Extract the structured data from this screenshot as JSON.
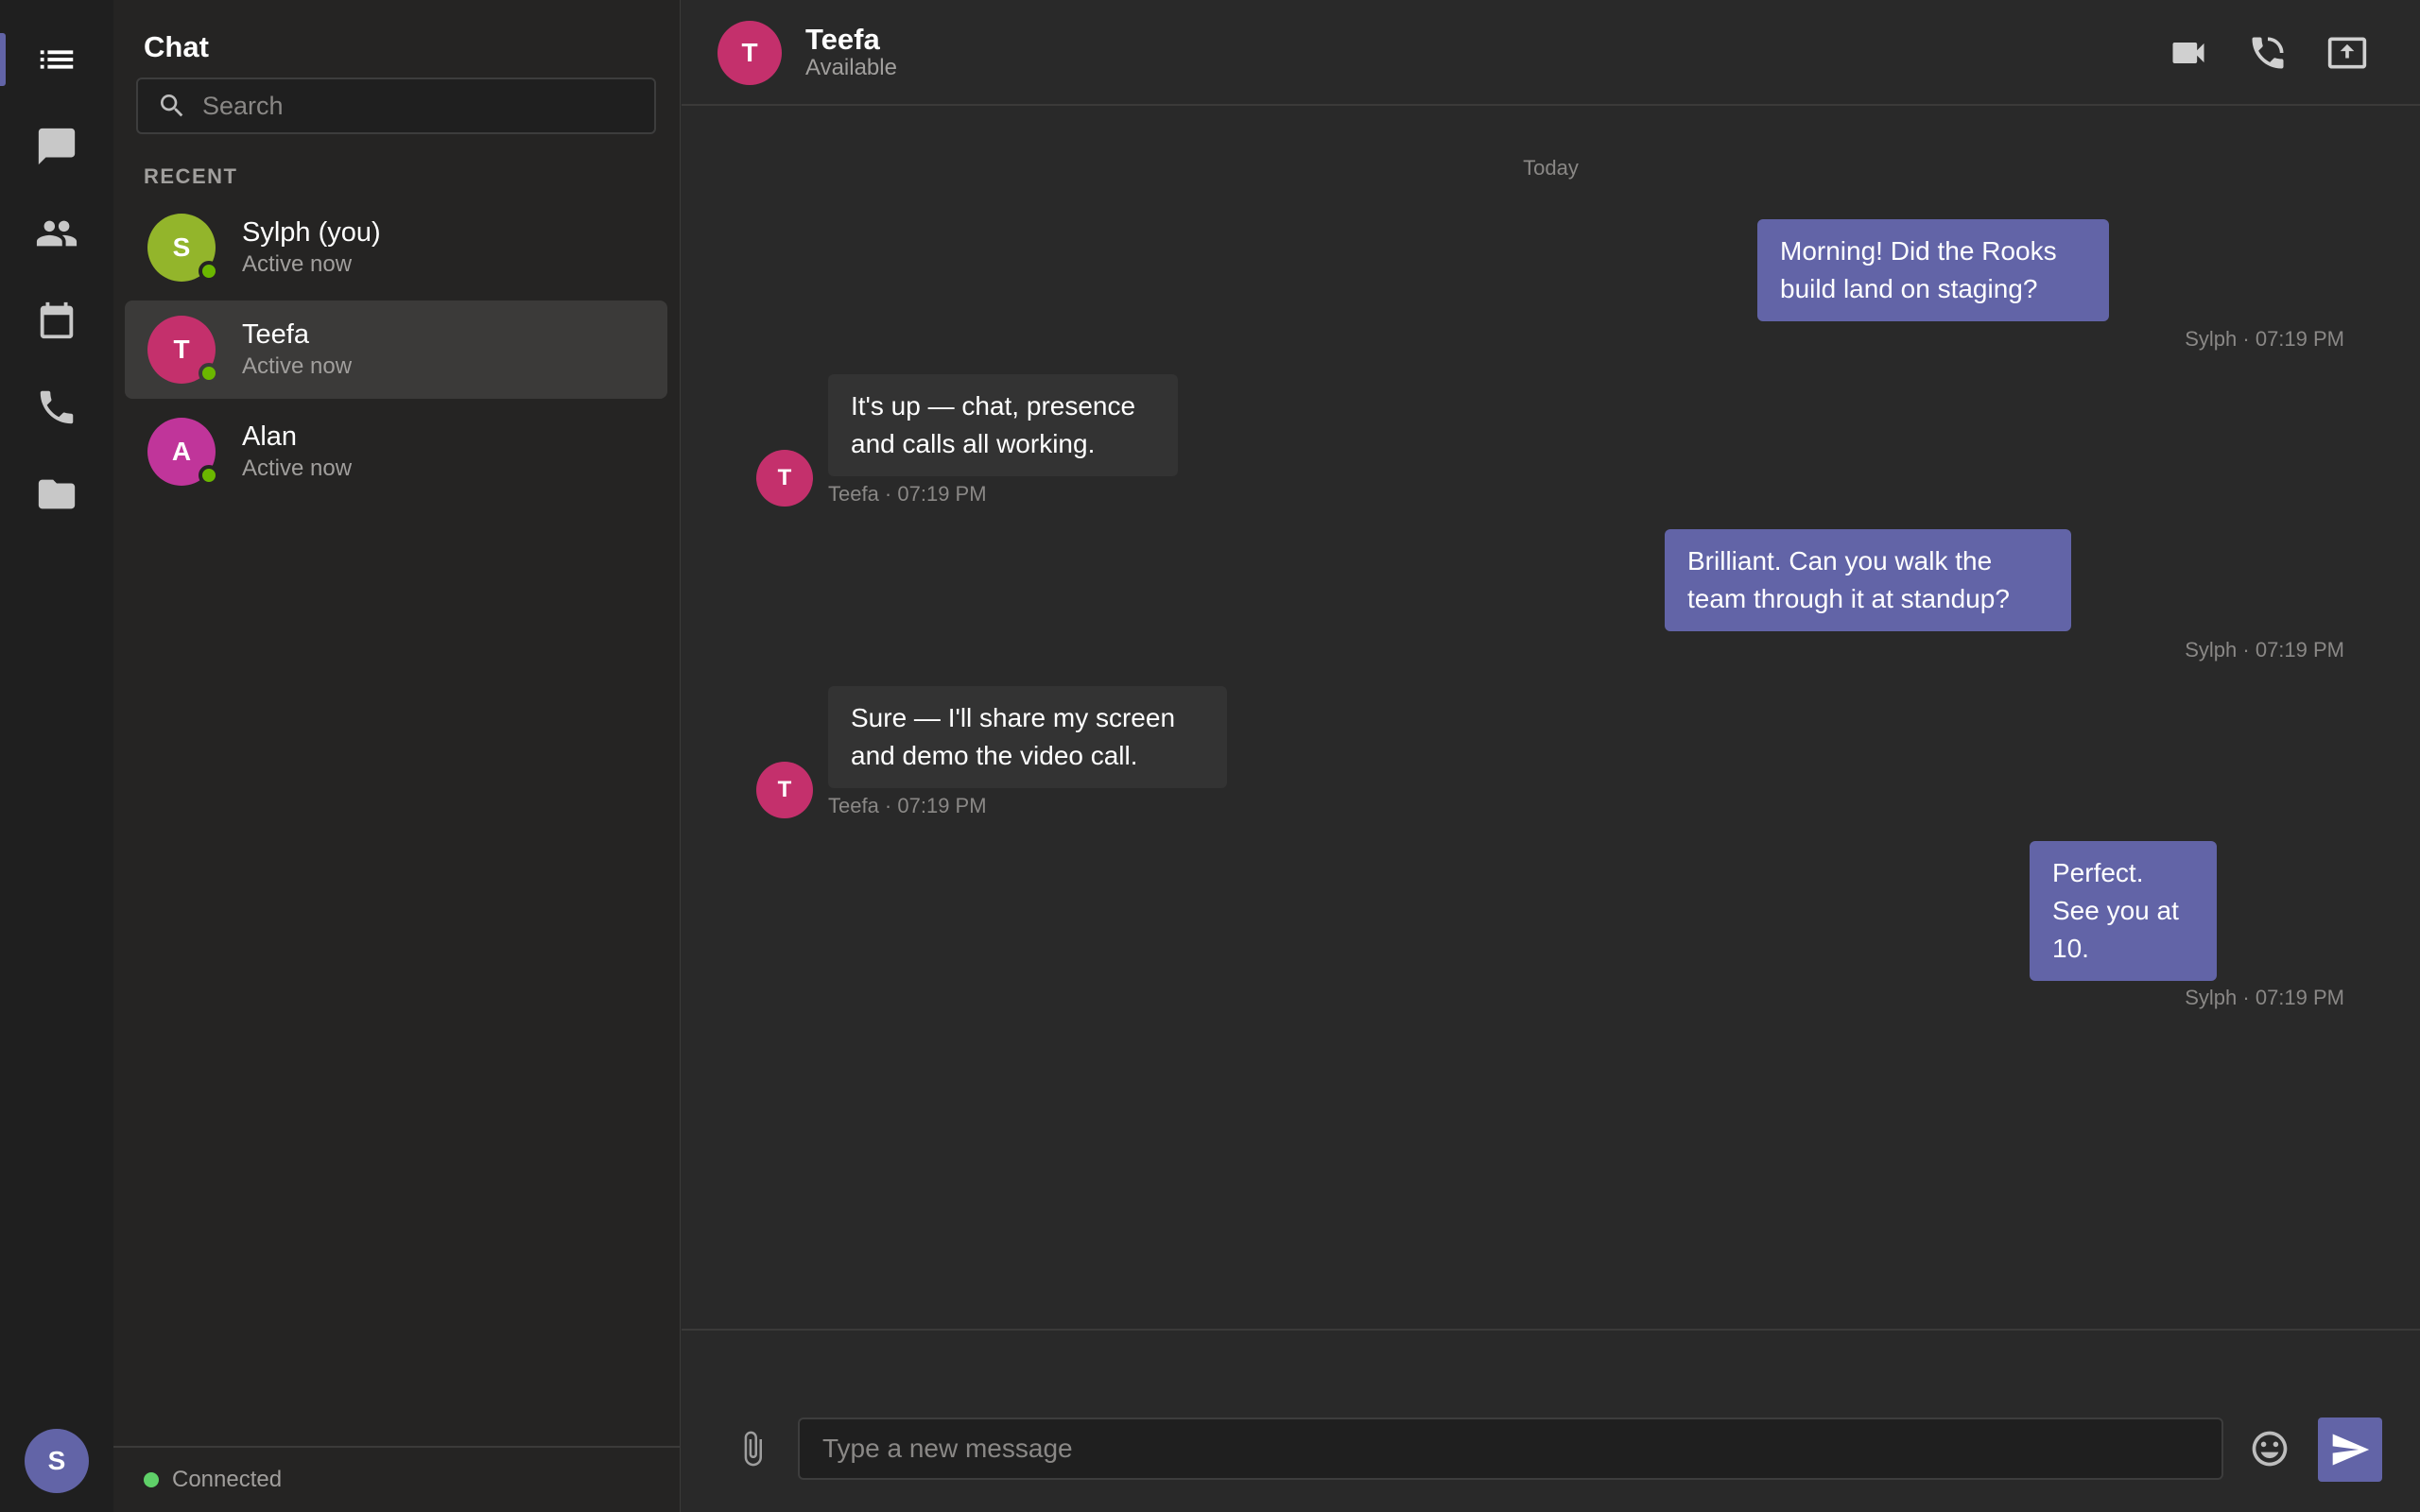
{
  "colors": {
    "accent": "#6264a7",
    "presence_online": "#6bb700",
    "avatar_sylph": "#93b52b",
    "avatar_teefa": "#c4306c",
    "avatar_alan": "#c0359a"
  },
  "rail": {
    "items": [
      {
        "name": "activity",
        "icon": "list-icon",
        "active": true
      },
      {
        "name": "chat",
        "icon": "chat-bubble-icon",
        "active": false
      },
      {
        "name": "teams",
        "icon": "people-icon",
        "active": false
      },
      {
        "name": "calendar",
        "icon": "calendar-icon",
        "active": false
      },
      {
        "name": "calls",
        "icon": "phone-icon",
        "active": false
      },
      {
        "name": "files",
        "icon": "folder-icon",
        "active": false
      }
    ],
    "user_initial": "S"
  },
  "panel": {
    "title": "Chat",
    "search_placeholder": "Search",
    "section_label": "RECENT",
    "contacts": [
      {
        "initial": "S",
        "name": "Sylph (you)",
        "status": "Active now",
        "selected": false
      },
      {
        "initial": "T",
        "name": "Teefa",
        "status": "Active now",
        "selected": true
      },
      {
        "initial": "A",
        "name": "Alan",
        "status": "Active now",
        "selected": false
      }
    ],
    "connection_status": "Connected"
  },
  "header": {
    "initial": "T",
    "name": "Teefa",
    "status": "Available",
    "actions": [
      "video-call-icon",
      "audio-call-icon",
      "share-screen-icon"
    ]
  },
  "conversation": {
    "day_label": "Today",
    "messages": [
      {
        "direction": "out",
        "text": "Morning! Did the Rooks build land on staging?",
        "meta": "Sylph · 07:19 PM"
      },
      {
        "direction": "in",
        "avatar": "T",
        "text": "It's up — chat, presence and calls all working.",
        "meta": "Teefa · 07:19 PM"
      },
      {
        "direction": "out",
        "text": "Brilliant. Can you walk the team through it at standup?",
        "meta": "Sylph · 07:19 PM"
      },
      {
        "direction": "in",
        "avatar": "T",
        "text": "Sure — I'll share my screen and demo the video call.",
        "meta": "Teefa · 07:19 PM"
      },
      {
        "direction": "out",
        "text": "Perfect. See you at 10.",
        "meta": "Sylph · 07:19 PM"
      }
    ]
  },
  "composer": {
    "placeholder": "Type a new message"
  }
}
